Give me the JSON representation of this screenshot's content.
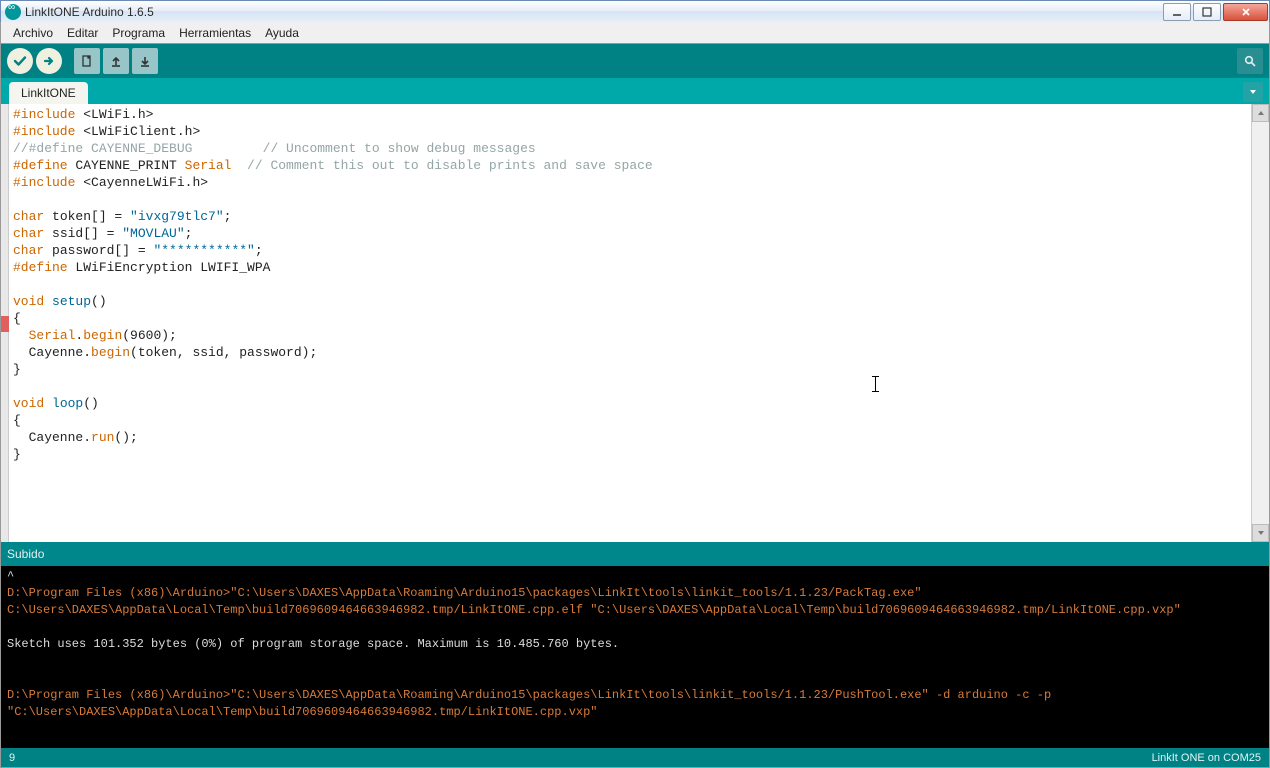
{
  "window": {
    "title": "LinkItONE Arduino 1.6.5"
  },
  "menu": {
    "file": "Archivo",
    "edit": "Editar",
    "sketch": "Programa",
    "tools": "Herramientas",
    "help": "Ayuda"
  },
  "tab": {
    "name": "LinkItONE"
  },
  "code": {
    "l01a": "#include",
    "l01b": " <LWiFi.h>",
    "l02a": "#include",
    "l02b": " <LWiFiClient.h>",
    "l03": "//#define CAYENNE_DEBUG         // Uncomment to show debug messages",
    "l04a": "#define",
    "l04b": " CAYENNE_PRINT ",
    "l04c": "Serial",
    "l04d": "  // Comment this out to disable prints and save space",
    "l05a": "#include",
    "l05b": " <CayenneLWiFi.h>",
    "l07a": "char",
    "l07b": " token[] = ",
    "l07c": "\"ivxg79tlc7\"",
    "l07d": ";",
    "l08a": "char",
    "l08b": " ssid[] = ",
    "l08c": "\"MOVLAU\"",
    "l08d": ";",
    "l09a": "char",
    "l09b": " password[] = ",
    "l09c": "\"***********\"",
    "l09d": ";",
    "l10a": "#define",
    "l10b": " LWiFiEncryption LWIFI_WPA",
    "l12a": "void",
    "l12b": " ",
    "l12c": "setup",
    "l12d": "()",
    "l13": "{",
    "l14a": "  ",
    "l14b": "Serial",
    "l14c": ".",
    "l14d": "begin",
    "l14e": "(9600);",
    "l15a": "  Cayenne.",
    "l15b": "begin",
    "l15c": "(token, ssid, password);",
    "l16": "}",
    "l18a": "void",
    "l18b": " ",
    "l18c": "loop",
    "l18d": "()",
    "l19": "{",
    "l20a": "  Cayenne.",
    "l20b": "run",
    "l20c": "();",
    "l21": "}"
  },
  "status": {
    "label": "Subido"
  },
  "console": {
    "caret": "^",
    "l1": "D:\\Program Files (x86)\\Arduino>\"C:\\Users\\DAXES\\AppData\\Roaming\\Arduino15\\packages\\LinkIt\\tools\\linkit_tools/1.1.23/PackTag.exe\" ",
    "l2": "C:\\Users\\DAXES\\AppData\\Local\\Temp\\build7069609464663946982.tmp/LinkItONE.cpp.elf \"C:\\Users\\DAXES\\AppData\\Local\\Temp\\build7069609464663946982.tmp/LinkItONE.cpp.vxp\"",
    "l3": "Sketch uses 101.352 bytes (0%) of program storage space. Maximum is 10.485.760 bytes.",
    "l4": "D:\\Program Files (x86)\\Arduino>\"C:\\Users\\DAXES\\AppData\\Roaming\\Arduino15\\packages\\LinkIt\\tools\\linkit_tools/1.1.23/PushTool.exe\" -d arduino -c -p ",
    "l5": "\"C:\\Users\\DAXES\\AppData\\Local\\Temp\\build7069609464663946982.tmp/LinkItONE.cpp.vxp\""
  },
  "footer": {
    "line": "9",
    "board": "LinkIt ONE on COM25"
  }
}
